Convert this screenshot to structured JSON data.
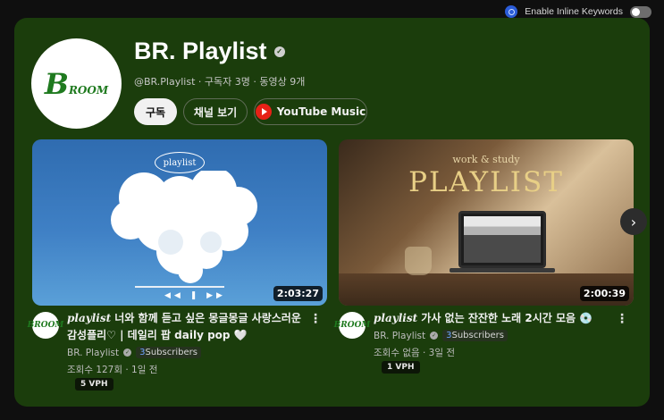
{
  "extension": {
    "label": "Enable Inline Keywords",
    "toggle_on": false
  },
  "channel": {
    "avatar_text_big": "B",
    "avatar_text_small": "ROOM",
    "name": "BR. Playlist",
    "meta": "@BR.Playlist · 구독자 3명 · 동영상 9개",
    "subscribe_label": "구독",
    "view_channel_label": "채널 보기",
    "music_label": "YouTube Music"
  },
  "videos": [
    {
      "thumb_oval": "playlist",
      "duration": "2:03:27",
      "title_lead": "playlist",
      "title_rest": " 너와 함께 듣고 싶은 몽글몽글 사랑스러운 감성플리♡ | 데일리 팝 daily pop 🤍",
      "channel": "BR. Playlist",
      "subs_num": "3",
      "subs_text": "Subscribers",
      "stats": "조회수 127회 · 1일 전",
      "vph": "5 VPH",
      "avatar_text": "BROOM"
    },
    {
      "thumb_top": "work & study",
      "thumb_title": "PLAYLIST",
      "duration": "2:00:39",
      "title_lead": "playlist",
      "title_rest": " 가사 없는 잔잔한 노래 2시간 모음 💿",
      "channel": "BR. Playlist",
      "subs_num": "3",
      "subs_text": "Subscribers",
      "stats": "조회수 없음 · 3일 전",
      "vph": "1 VPH",
      "avatar_text": "BROOM"
    }
  ],
  "icons": {
    "next": "chevron-right-icon",
    "kebab": "more-vert-icon",
    "verified": "verified-check-icon",
    "music": "youtube-music-icon",
    "extension": "extension-icon"
  },
  "colors": {
    "card_bg": "#1b3d0c",
    "page_bg": "#0f0f0f",
    "brand_green": "#1f7a1f",
    "music_red": "#e62117"
  }
}
